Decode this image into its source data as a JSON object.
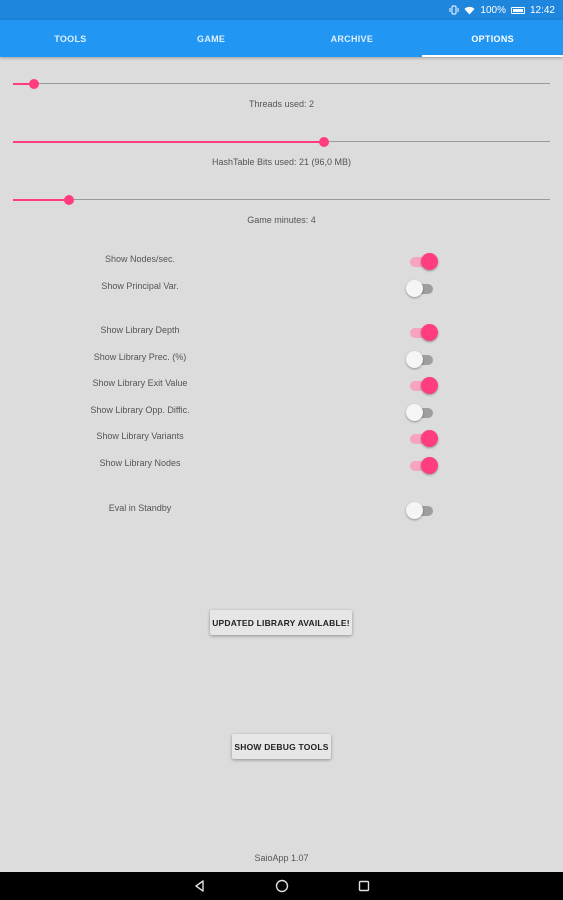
{
  "status_bar": {
    "battery_text": "100%",
    "time": "12:42",
    "icons": [
      "vibrate-icon",
      "wifi-icon",
      "battery-icon"
    ]
  },
  "tabs": [
    {
      "label": "TOOLS",
      "active": false
    },
    {
      "label": "GAME",
      "active": false
    },
    {
      "label": "ARCHIVE",
      "active": false
    },
    {
      "label": "OPTIONS",
      "active": true
    }
  ],
  "sliders": {
    "threads": {
      "label": "Threads used: 2",
      "fraction": 0.04
    },
    "hashtable": {
      "label": "HashTable Bits used: 21 (96,0 MB)",
      "fraction": 0.58
    },
    "game_minutes": {
      "label": "Game minutes: 4",
      "fraction": 0.105
    }
  },
  "toggles": {
    "nodes_sec": {
      "label": "Show Nodes/sec.",
      "on": true
    },
    "principal_var": {
      "label": "Show Principal Var.",
      "on": false
    },
    "library_depth": {
      "label": "Show Library Depth",
      "on": true
    },
    "library_prec": {
      "label": "Show Library Prec. (%)",
      "on": false
    },
    "library_exit_value": {
      "label": "Show Library Exit Value",
      "on": true
    },
    "library_opp_diffic": {
      "label": "Show Library Opp. Diffic.",
      "on": false
    },
    "library_variants": {
      "label": "Show Library Variants",
      "on": true
    },
    "library_nodes": {
      "label": "Show Library Nodes",
      "on": true
    },
    "eval_standby": {
      "label": "Eval in Standby",
      "on": false
    }
  },
  "buttons": {
    "updated_library": "UPDATED LIBRARY AVAILABLE!",
    "debug_tools": "SHOW DEBUG TOOLS"
  },
  "footer": {
    "version": "SaioApp 1.07"
  },
  "colors": {
    "status_bar": "#1f86dd",
    "tab_bar": "#2196f3",
    "accent": "#ff3d7f",
    "accent_light": "#f6a4c1",
    "background": "#dcdcdc",
    "nav_bar": "#000000"
  },
  "nav_bar": {
    "icons": [
      "back-icon",
      "home-icon",
      "recents-icon"
    ]
  }
}
